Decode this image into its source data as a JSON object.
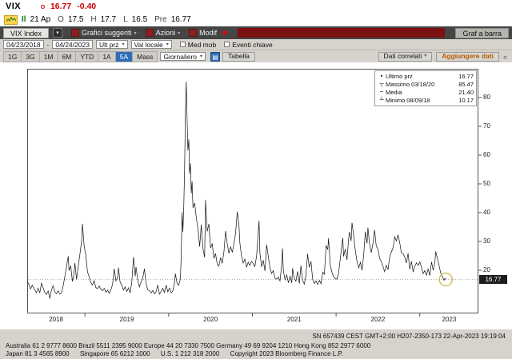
{
  "quote": {
    "ticker": "VIX",
    "last": "16.77",
    "change": "-0.40",
    "session_label": "Il",
    "session_date": "21 Ap",
    "open_label": "O",
    "open": "17.5",
    "high_label": "H",
    "high": "17.7",
    "low_label": "L",
    "low": "16.5",
    "prev_label": "Pre",
    "prev": "16.77"
  },
  "menubar": {
    "security_tab": "VIX Index",
    "items": [
      "Grafici suggeriti",
      "Azioni",
      "Modif"
    ],
    "chart_type_button": "Graf a barra"
  },
  "toolbar": {
    "date_from": "04/23/2018",
    "date_to": "04/24/2023",
    "field_select": "Ult prz",
    "currency_select": "Val locale",
    "mov_avg_label": "Med mob",
    "key_events_label": "Eventi chiave",
    "periods": [
      "1G",
      "3G",
      "1M",
      "6M",
      "YTD",
      "1A",
      "5A",
      "Mass"
    ],
    "active_period": "5A",
    "frequency_select": "Giornaliero",
    "table_button": "Tabella",
    "related_data_button": "Dati correlati",
    "add_data_button": "Aggiungere dati"
  },
  "icons": {
    "caret_down": "▾",
    "collapse_chevron": "«",
    "grid": "▤"
  },
  "legend": {
    "rows": [
      {
        "marker": "▪",
        "label": "Ultimo prz",
        "value": "16.77"
      },
      {
        "marker": "┬",
        "label": "Massimo 03/18/20",
        "value": "85.47"
      },
      {
        "marker": "╌",
        "label": "Media",
        "value": "21.40"
      },
      {
        "marker": "┴",
        "label": "Minimo 08/09/18",
        "value": "10.17"
      }
    ]
  },
  "axis": {
    "y_ticks": [
      80,
      70,
      60,
      50,
      40,
      30,
      20
    ],
    "x_labels": [
      "2018",
      "2019",
      "2020",
      "2021",
      "2022",
      "2023"
    ],
    "last_price_marker": "16.77"
  },
  "chart_data": {
    "type": "line",
    "title": "VIX Index - Ultimo prz (5 anni, giornaliero)",
    "series_name": "Ultimo prz",
    "xlim": [
      2018.31,
      2023.7
    ],
    "ylim": [
      5,
      90
    ],
    "last_price": 16.77,
    "high": {
      "date": "03/18/20",
      "value": 85.47
    },
    "low": {
      "date": "08/09/18",
      "value": 10.17
    },
    "mean": 21.4,
    "x": [
      2018.31,
      2018.33,
      2018.35,
      2018.37,
      2018.4,
      2018.42,
      2018.44,
      2018.46,
      2018.48,
      2018.5,
      2018.52,
      2018.54,
      2018.56,
      2018.58,
      2018.6,
      2018.62,
      2018.64,
      2018.66,
      2018.68,
      2018.7,
      2018.72,
      2018.74,
      2018.76,
      2018.78,
      2018.8,
      2018.81,
      2018.83,
      2018.85,
      2018.87,
      2018.88,
      2018.9,
      2018.92,
      2018.94,
      2018.96,
      2018.97,
      2018.99,
      2019.01,
      2019.03,
      2019.05,
      2019.07,
      2019.09,
      2019.11,
      2019.13,
      2019.15,
      2019.17,
      2019.19,
      2019.21,
      2019.23,
      2019.25,
      2019.27,
      2019.29,
      2019.31,
      2019.33,
      2019.35,
      2019.37,
      2019.39,
      2019.4,
      2019.42,
      2019.44,
      2019.46,
      2019.48,
      2019.5,
      2019.52,
      2019.54,
      2019.56,
      2019.58,
      2019.6,
      2019.61,
      2019.63,
      2019.65,
      2019.67,
      2019.69,
      2019.71,
      2019.73,
      2019.75,
      2019.77,
      2019.79,
      2019.81,
      2019.83,
      2019.85,
      2019.87,
      2019.89,
      2019.91,
      2019.93,
      2019.95,
      2019.97,
      2019.99,
      2020.01,
      2020.03,
      2020.05,
      2020.07,
      2020.08,
      2020.1,
      2020.12,
      2020.14,
      2020.15,
      2020.16,
      2020.17,
      2020.18,
      2020.19,
      2020.2,
      2020.21,
      2020.22,
      2020.23,
      2020.24,
      2020.25,
      2020.26,
      2020.27,
      2020.28,
      2020.29,
      2020.31,
      2020.33,
      2020.35,
      2020.37,
      2020.39,
      2020.41,
      2020.43,
      2020.44,
      2020.46,
      2020.48,
      2020.5,
      2020.52,
      2020.54,
      2020.56,
      2020.58,
      2020.6,
      2020.62,
      2020.64,
      2020.66,
      2020.68,
      2020.7,
      2020.72,
      2020.74,
      2020.76,
      2020.78,
      2020.8,
      2020.82,
      2020.83,
      2020.84,
      2020.85,
      2020.87,
      2020.89,
      2020.91,
      2020.93,
      2020.95,
      2020.97,
      2020.99,
      2021.01,
      2021.03,
      2021.05,
      2021.07,
      2021.08,
      2021.09,
      2021.11,
      2021.13,
      2021.15,
      2021.17,
      2021.19,
      2021.21,
      2021.23,
      2021.25,
      2021.27,
      2021.29,
      2021.31,
      2021.33,
      2021.35,
      2021.36,
      2021.37,
      2021.39,
      2021.41,
      2021.43,
      2021.45,
      2021.47,
      2021.48,
      2021.5,
      2021.52,
      2021.54,
      2021.56,
      2021.58,
      2021.6,
      2021.62,
      2021.64,
      2021.66,
      2021.68,
      2021.7,
      2021.72,
      2021.74,
      2021.76,
      2021.78,
      2021.8,
      2021.82,
      2021.84,
      2021.86,
      2021.88,
      2021.9,
      2021.91,
      2021.93,
      2021.95,
      2021.97,
      2021.99,
      2022.01,
      2022.03,
      2022.05,
      2022.07,
      2022.08,
      2022.09,
      2022.11,
      2022.13,
      2022.15,
      2022.16,
      2022.18,
      2022.19,
      2022.21,
      2022.23,
      2022.25,
      2022.27,
      2022.29,
      2022.31,
      2022.33,
      2022.35,
      2022.37,
      2022.38,
      2022.4,
      2022.42,
      2022.44,
      2022.46,
      2022.48,
      2022.5,
      2022.52,
      2022.54,
      2022.56,
      2022.58,
      2022.6,
      2022.62,
      2022.64,
      2022.66,
      2022.68,
      2022.7,
      2022.72,
      2022.74,
      2022.76,
      2022.78,
      2022.8,
      2022.82,
      2022.84,
      2022.86,
      2022.88,
      2022.9,
      2022.92,
      2022.94,
      2022.96,
      2022.98,
      2023.0,
      2023.02,
      2023.04,
      2023.06,
      2023.08,
      2023.1,
      2023.12,
      2023.14,
      2023.16,
      2023.18,
      2023.19,
      2023.21,
      2023.23,
      2023.25,
      2023.27,
      2023.29,
      2023.3,
      2023.31
    ],
    "y": [
      16.3,
      15.0,
      13.5,
      14.8,
      13.2,
      12.2,
      13.8,
      12.1,
      15.5,
      13.9,
      12.3,
      11.6,
      12.8,
      10.2,
      13.2,
      14.6,
      12.5,
      11.8,
      12.9,
      11.7,
      12.1,
      14.7,
      17.9,
      21.3,
      24.9,
      19.9,
      21.5,
      16.1,
      19.0,
      22.5,
      16.9,
      21.4,
      25.6,
      30.1,
      36.1,
      28.3,
      25.4,
      19.5,
      17.8,
      15.7,
      14.9,
      16.4,
      14.0,
      13.6,
      14.5,
      13.4,
      12.9,
      13.7,
      12.4,
      13.1,
      12.0,
      13.1,
      15.1,
      20.5,
      16.3,
      17.5,
      20.9,
      15.9,
      14.8,
      13.1,
      14.2,
      12.6,
      13.9,
      12.1,
      16.1,
      24.6,
      17.9,
      21.1,
      16.9,
      14.2,
      15.8,
      17.2,
      20.5,
      15.4,
      13.2,
      12.9,
      12.1,
      13.0,
      11.8,
      12.5,
      14.9,
      11.7,
      12.6,
      13.7,
      12.3,
      14.8,
      12.5,
      13.8,
      12.1,
      12.9,
      15.6,
      18.8,
      15.5,
      14.8,
      17.1,
      25.0,
      40.1,
      33.4,
      41.9,
      54.5,
      75.5,
      85.47,
      72.0,
      61.6,
      65.5,
      53.5,
      57.1,
      46.7,
      50.9,
      41.7,
      43.4,
      38.2,
      34.2,
      28.2,
      35.9,
      27.5,
      24.5,
      44.4,
      33.5,
      36.1,
      27.7,
      29.3,
      24.1,
      25.8,
      22.1,
      21.4,
      24.4,
      22.4,
      26.4,
      33.6,
      29.1,
      25.9,
      28.1,
      26.2,
      29.4,
      33.0,
      40.3,
      38.0,
      35.6,
      29.6,
      24.8,
      22.5,
      23.9,
      21.0,
      22.8,
      21.7,
      23.1,
      22.4,
      21.3,
      24.9,
      33.1,
      37.2,
      25.9,
      21.2,
      23.5,
      19.7,
      28.9,
      24.7,
      20.7,
      18.9,
      19.8,
      17.3,
      16.9,
      17.6,
      16.3,
      21.8,
      27.6,
      19.9,
      16.7,
      18.4,
      15.7,
      17.9,
      15.6,
      20.7,
      17.2,
      16.2,
      19.6,
      15.4,
      21.6,
      16.4,
      15.2,
      18.2,
      25.7,
      21.0,
      23.1,
      16.9,
      15.4,
      16.3,
      15.1,
      16.5,
      15.3,
      19.4,
      18.6,
      28.6,
      27.2,
      31.1,
      21.9,
      19.3,
      17.7,
      17.2,
      16.9,
      19.2,
      23.9,
      28.9,
      31.2,
      24.8,
      27.4,
      23.6,
      31.0,
      33.3,
      30.2,
      36.5,
      32.0,
      26.7,
      23.0,
      20.8,
      22.7,
      20.0,
      25.4,
      33.4,
      29.3,
      34.8,
      28.9,
      26.1,
      29.4,
      34.0,
      28.4,
      27.5,
      24.2,
      23.0,
      21.3,
      19.5,
      21.7,
      20.2,
      24.6,
      26.3,
      27.8,
      31.6,
      30.2,
      32.3,
      29.7,
      26.0,
      25.8,
      24.6,
      22.5,
      25.9,
      20.4,
      23.1,
      19.4,
      21.4,
      22.6,
      21.7,
      22.9,
      21.1,
      18.8,
      19.9,
      18.3,
      20.5,
      18.1,
      22.9,
      20.0,
      22.6,
      26.5,
      24.2,
      21.7,
      19.0,
      17.8,
      16.5,
      17.2,
      16.77
    ]
  },
  "footer": {
    "status": "SN 657439 CEST GMT+2:00 H207-2350-173 22-Apr-2023 19:19:04",
    "line1": "Australia 61 2 9777 8600 Brazil 5511 2395 9000 Europe 44 20 7330 7500 Germany 49 69 9204 1210 Hong Kong 852 2977 6000",
    "line2": "Japan 81 3 4565 8900      Singapore 65 6212 1000      U.S. 1 212 318 2000      Copyright 2023 Bloomberg Finance L.P."
  },
  "colors": {
    "price_down": "#cc0000",
    "accent_blue": "#2f6db4",
    "amber": "#b35900",
    "menubar_bg": "#454545",
    "alert_strip_red": "#7b1113",
    "chart_line": "#101010",
    "highlight_yellow": "#cfc264"
  }
}
